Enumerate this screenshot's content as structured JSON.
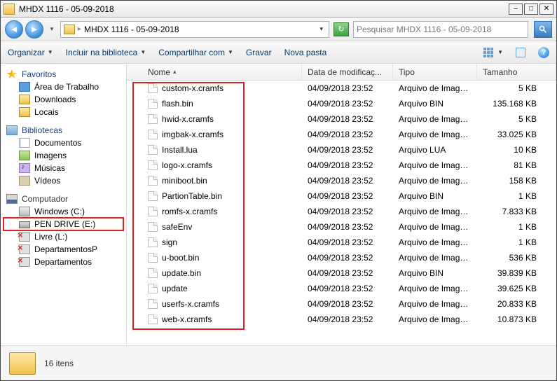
{
  "window": {
    "title": "MHDX 1116 - 05-09-2018"
  },
  "nav": {
    "path_segment": "MHDX 1116 - 05-09-2018",
    "search_placeholder": "Pesquisar MHDX 1116 - 05-09-2018"
  },
  "toolbar": {
    "organize": "Organizar",
    "include": "Incluir na biblioteca",
    "share": "Compartilhar com",
    "burn": "Gravar",
    "new_folder": "Nova pasta"
  },
  "sidebar": {
    "favorites": {
      "label": "Favoritos",
      "items": [
        "Área de Trabalho",
        "Downloads",
        "Locais"
      ]
    },
    "libraries": {
      "label": "Bibliotecas",
      "items": [
        "Documentos",
        "Imagens",
        "Músicas",
        "Vídeos"
      ]
    },
    "computer": {
      "label": "Computador",
      "items": [
        {
          "label": "Windows (C:)",
          "type": "disk",
          "selected": false
        },
        {
          "label": "PEN DRIVE (E:)",
          "type": "drive",
          "selected": true
        },
        {
          "label": "Livre (L:)",
          "type": "net",
          "selected": false
        },
        {
          "label": "DepartamentosP",
          "type": "net",
          "selected": false
        },
        {
          "label": "Departamentos",
          "type": "net",
          "selected": false
        }
      ]
    }
  },
  "columns": {
    "name": "Nome",
    "date": "Data de modificaç...",
    "type": "Tipo",
    "size": "Tamanho"
  },
  "files": [
    {
      "name": "custom-x.cramfs",
      "date": "04/09/2018 23:52",
      "type": "Arquivo de Image...",
      "size": "5 KB"
    },
    {
      "name": "flash.bin",
      "date": "04/09/2018 23:52",
      "type": "Arquivo BIN",
      "size": "135.168 KB"
    },
    {
      "name": "hwid-x.cramfs",
      "date": "04/09/2018 23:52",
      "type": "Arquivo de Image...",
      "size": "5 KB"
    },
    {
      "name": "imgbak-x.cramfs",
      "date": "04/09/2018 23:52",
      "type": "Arquivo de Image...",
      "size": "33.025 KB"
    },
    {
      "name": "Install.lua",
      "date": "04/09/2018 23:52",
      "type": "Arquivo LUA",
      "size": "10 KB"
    },
    {
      "name": "logo-x.cramfs",
      "date": "04/09/2018 23:52",
      "type": "Arquivo de Image...",
      "size": "81 KB"
    },
    {
      "name": "miniboot.bin",
      "date": "04/09/2018 23:52",
      "type": "Arquivo de Image...",
      "size": "158 KB"
    },
    {
      "name": "PartionTable.bin",
      "date": "04/09/2018 23:52",
      "type": "Arquivo BIN",
      "size": "1 KB"
    },
    {
      "name": "romfs-x.cramfs",
      "date": "04/09/2018 23:52",
      "type": "Arquivo de Image...",
      "size": "7.833 KB"
    },
    {
      "name": "safeEnv",
      "date": "04/09/2018 23:52",
      "type": "Arquivo de Image...",
      "size": "1 KB"
    },
    {
      "name": "sign",
      "date": "04/09/2018 23:52",
      "type": "Arquivo de Image...",
      "size": "1 KB"
    },
    {
      "name": "u-boot.bin",
      "date": "04/09/2018 23:52",
      "type": "Arquivo de Image...",
      "size": "536 KB"
    },
    {
      "name": "update.bin",
      "date": "04/09/2018 23:52",
      "type": "Arquivo BIN",
      "size": "39.839 KB"
    },
    {
      "name": "update",
      "date": "04/09/2018 23:52",
      "type": "Arquivo de Image...",
      "size": "39.625 KB"
    },
    {
      "name": "userfs-x.cramfs",
      "date": "04/09/2018 23:52",
      "type": "Arquivo de Image...",
      "size": "20.833 KB"
    },
    {
      "name": "web-x.cramfs",
      "date": "04/09/2018 23:52",
      "type": "Arquivo de Image...",
      "size": "10.873 KB"
    }
  ],
  "status": {
    "count_text": "16 itens"
  }
}
